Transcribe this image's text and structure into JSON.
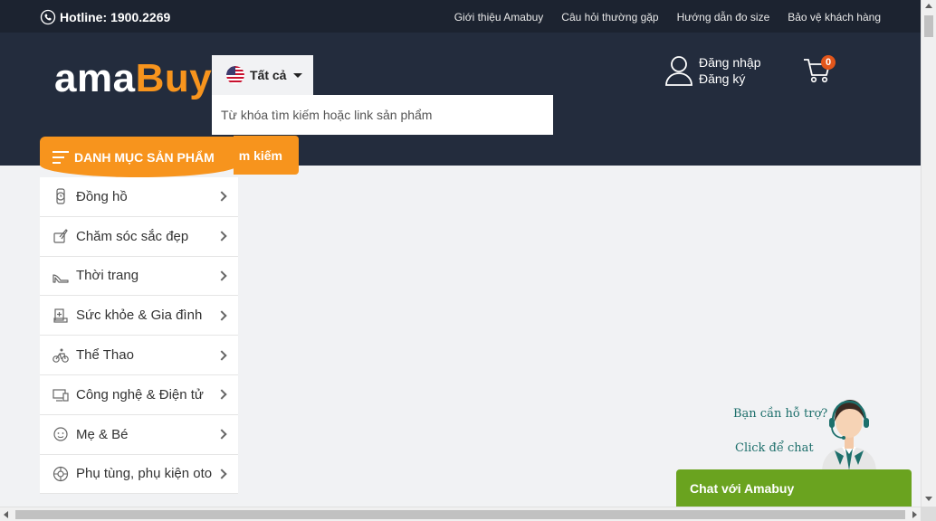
{
  "topbar": {
    "hotline_label": "Hotline:",
    "hotline_number": "1900.2269",
    "links": [
      "Giới thiệu Amabuy",
      "Câu hỏi thường gặp",
      "Hướng dẫn đo size",
      "Bảo vệ khách hàng"
    ]
  },
  "header": {
    "logo_part1": "ama",
    "logo_part2": "Buy",
    "category_selected": "Tất cả",
    "search_placeholder": "Từ khóa tìm kiếm hoặc link sản phẩm",
    "search_button": "m kiếm",
    "login": "Đăng nhập",
    "register": "Đăng ký",
    "cart_count": "0"
  },
  "menu": {
    "title": "DANH MỤC SẢN PHẨM",
    "items": [
      {
        "label": "Đồng hồ",
        "icon": "watch-icon"
      },
      {
        "label": "Chăm sóc sắc đẹp",
        "icon": "beauty-icon"
      },
      {
        "label": "Thời trang",
        "icon": "high-heel-icon"
      },
      {
        "label": "Sức khỏe & Gia đình",
        "icon": "health-icon"
      },
      {
        "label": "Thể Thao",
        "icon": "bicycle-icon"
      },
      {
        "label": "Công nghệ & Điện tử",
        "icon": "computer-icon"
      },
      {
        "label": "Mẹ & Bé",
        "icon": "baby-icon"
      },
      {
        "label": "Phụ tùng, phụ kiện oto",
        "icon": "wheel-icon"
      }
    ]
  },
  "chat": {
    "help_text": "Bạn cần hỗ trợ?",
    "click_text": "Click để chat",
    "bar_label": "Chat với Amabuy"
  },
  "colors": {
    "topbar": "#1c2330",
    "header": "#232c3d",
    "accent": "#f7941d",
    "chat": "#6aa31f"
  }
}
